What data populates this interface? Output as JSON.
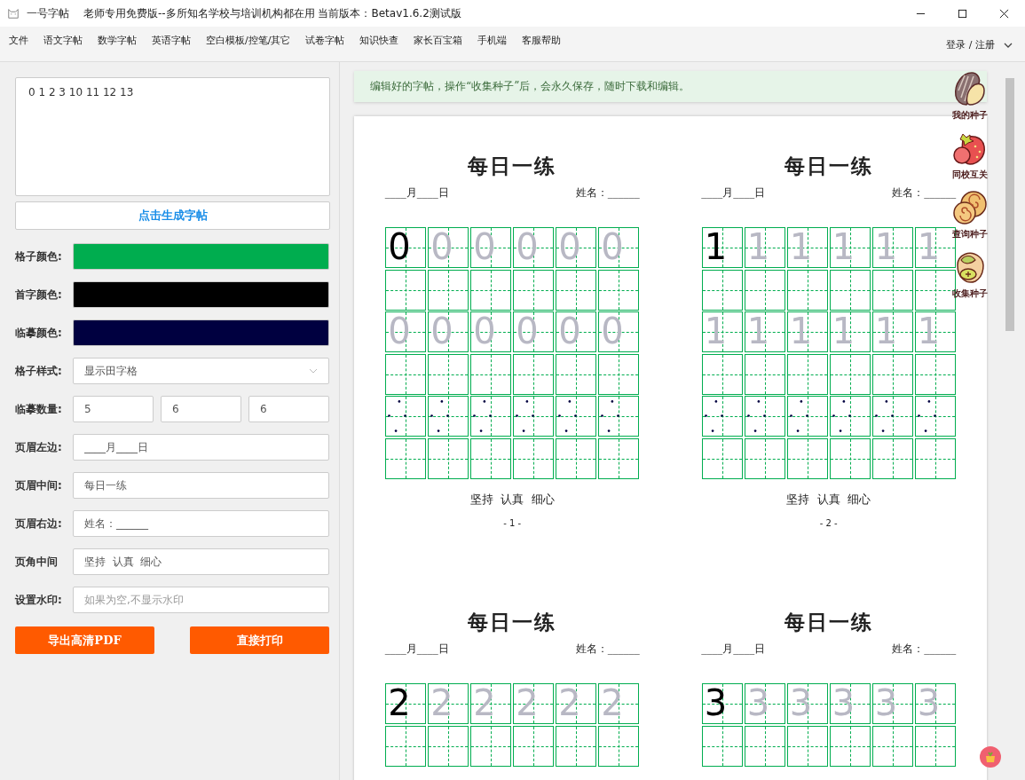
{
  "window": {
    "app_name": "一号字帖",
    "title": "老师专用免费版--多所知名学校与培训机构都在用 当前版本：Betav1.6.2测试版"
  },
  "menu": [
    "文件",
    "语文字帖",
    "数学字帖",
    "英语字帖",
    "空白模板/控笔/其它",
    "试卷字帖",
    "知识快查",
    "家长百宝箱",
    "手机端",
    "客服帮助"
  ],
  "account": {
    "label": "登录 / 注册"
  },
  "editor": {
    "content": "0 1 2 3 10 11 12 13",
    "generate_button": "点击生成字帖",
    "colors": [
      {
        "label": "格子颜色:",
        "color": "#00ad4f"
      },
      {
        "label": "首字颜色:",
        "color": "#000000"
      },
      {
        "label": "临摹颜色:",
        "color": "#000040"
      }
    ],
    "grid_style": {
      "label": "格子样式:",
      "value": "显示田字格"
    },
    "copy_count": {
      "label": "临摹数量:",
      "values": [
        "5",
        "6",
        "6"
      ]
    },
    "fields": [
      {
        "label": "页眉左边:",
        "value": "____月____日"
      },
      {
        "label": "页眉中间:",
        "value": "每日一练"
      },
      {
        "label": "页眉右边:",
        "value": "姓名：______"
      },
      {
        "label": "页角中间",
        "value": "坚持  认真  细心"
      },
      {
        "label": "设置水印:",
        "placeholder": "如果为空,不显示水印"
      }
    ],
    "buttons": [
      "导出高清PDF",
      "直接打印"
    ]
  },
  "notice": "编辑好的字帖，操作“收集种子”后，会永久保存，随时下载和编辑。",
  "sheets": [
    {
      "title": "每日一练",
      "header_left": "____月____日",
      "header_right": "姓名：______",
      "rows": [
        {
          "kind": "model",
          "cells": [
            "0",
            "0",
            "0",
            "0",
            "0",
            "0"
          ]
        },
        {
          "kind": "blank"
        },
        {
          "kind": "traced",
          "cells": [
            "0",
            "0",
            "0",
            "0",
            "0",
            "0"
          ]
        },
        {
          "kind": "blank"
        },
        {
          "kind": "points"
        },
        {
          "kind": "blank"
        }
      ],
      "footer": "坚持  认真  细心",
      "page": "- 1 -"
    },
    {
      "title": "每日一练",
      "header_left": "____月____日",
      "header_right": "姓名：______",
      "rows": [
        {
          "kind": "model",
          "cells": [
            "1",
            "1",
            "1",
            "1",
            "1",
            "1"
          ]
        },
        {
          "kind": "blank"
        },
        {
          "kind": "traced",
          "cells": [
            "1",
            "1",
            "1",
            "1",
            "1",
            "1"
          ]
        },
        {
          "kind": "blank"
        },
        {
          "kind": "points"
        },
        {
          "kind": "blank"
        }
      ],
      "footer": "坚持  认真  细心",
      "page": "- 2 -"
    },
    {
      "title": "每日一练",
      "header_left": "____月____日",
      "header_right": "姓名：______",
      "rows": [
        {
          "kind": "model",
          "cells": [
            "2",
            "2",
            "2",
            "2",
            "2",
            "2"
          ]
        },
        {
          "kind": "blank"
        }
      ]
    },
    {
      "title": "每日一练",
      "header_left": "____月____日",
      "header_right": "姓名：______",
      "rows": [
        {
          "kind": "model",
          "cells": [
            "3",
            "3",
            "3",
            "3",
            "3",
            "3"
          ]
        },
        {
          "kind": "blank"
        }
      ]
    }
  ],
  "seed_menu": [
    {
      "label": "我的种子",
      "kind": "seed"
    },
    {
      "label": "同校互关",
      "kind": "strawberry"
    },
    {
      "label": "查询种子",
      "kind": "snail"
    },
    {
      "label": "收集种子",
      "kind": "nut"
    }
  ]
}
